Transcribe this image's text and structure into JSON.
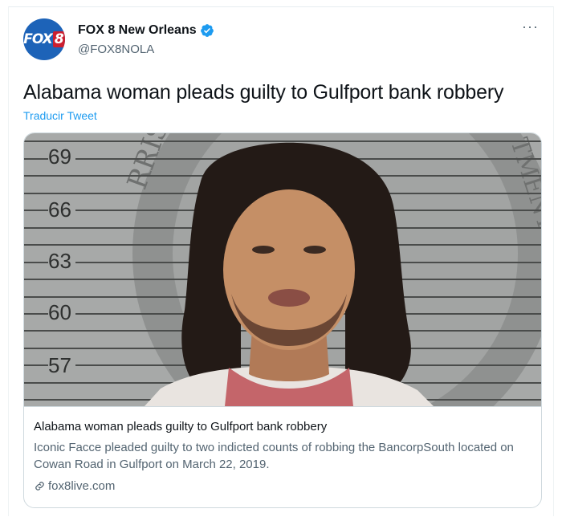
{
  "account": {
    "display_name": "FOX 8 New Orleans",
    "handle": "@FOX8NOLA",
    "avatar_text_a": "FOX",
    "avatar_text_b": "8",
    "verified": true,
    "brand_color": "#1d63b8",
    "verified_color": "#1d9bf0"
  },
  "tweet": {
    "text": "Alabama woman pleads guilty to Gulfport bank robbery",
    "translate_label": "Traducir Tweet",
    "more_label": "···"
  },
  "card": {
    "ruler_marks": [
      "69",
      "66",
      "63",
      "60",
      "57"
    ],
    "seal_text_left": "RRIS",
    "seal_text_right": "TMENT",
    "title": "Alabama woman pleads guilty to Gulfport bank robbery",
    "description": "Iconic Facce pleaded guilty to two indicted counts of robbing the BancorpSouth located on Cowan Road in Gulfport on March 22, 2019.",
    "domain": "fox8live.com",
    "link_icon": "link-icon",
    "image_subject": "mugshot-photo"
  }
}
